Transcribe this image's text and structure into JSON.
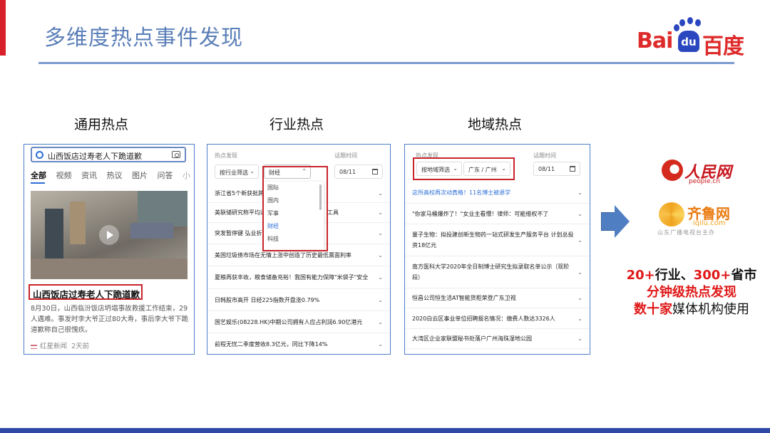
{
  "slide": {
    "title": "多维度热点事件发现",
    "logo": {
      "part1": "Bai",
      "du": "du",
      "part2": "百度"
    }
  },
  "headings": {
    "general": "通用热点",
    "industry": "行业热点",
    "region": "地域热点"
  },
  "general_panel": {
    "search_value": "山西饭店过寿老人下跪道歉",
    "tabs": [
      {
        "label": "全部",
        "active": true
      },
      {
        "label": "视频"
      },
      {
        "label": "资讯"
      },
      {
        "label": "热议"
      },
      {
        "label": "图片"
      },
      {
        "label": "问答"
      },
      {
        "label": "小"
      }
    ],
    "headline": "山西饭店过寿老人下跪道歉",
    "description": "8月30日，山西临汾饭店坍塌事故救援工作结束，29人遇难。事发时李大爷正过80大寿，事后李大爷下跪道歉称自己很愧疚。",
    "source_name": "红星新闻",
    "source_time": "2天前"
  },
  "industry_panel": {
    "filter_label": "热点发现",
    "time_label": "话题时间",
    "filter_select": "按行业筛选",
    "category_select": "财经",
    "date_value": "08/11",
    "dropdown_options": [
      "国际",
      "国内",
      "军事",
      "财经",
      "科技"
    ],
    "dropdown_selected": "财经",
    "rows": [
      "浙江省5个新获批跨境",
      "美联储研究称平均通",
      "突发暂停键 弘业折载",
      "美国垃圾债市场在无情上涨中创造了历史最低票面利率",
      "夏粮再获丰收，粮食储备充裕！我国有能力保障\"米袋子\"安全",
      "日韩股市高开 日经225指数开盘涨0.79%",
      "国艺娱乐(08228.HK)中期公司拥有人应占利润6.90亿港元",
      "前程无忧二季度营收8.3亿元，同比下降14%"
    ],
    "row2_tail": "工具"
  },
  "region_panel": {
    "filter_label": "热点发现",
    "time_label": "话题时间",
    "filter_select": "按地域筛选",
    "region_select": "广东 / 广州",
    "date_value": "08/11",
    "rows": [
      "这所高校再次动真格！11名博士被退学",
      "\"你家马桶爆炸了！\"女业主看懵！律师：可能维权不了",
      "量子生物：拟投建创新生物药一站式研发生产服务平台 计划总投资18亿元",
      "南方医科大学2020年全日制博士研究生拟录取名单公示（现阶段）",
      "恒昌公司恒生活AT智能货柜荣登广东卫视",
      "2020白云区事业单位招聘报名情况：缴费人数达3326人",
      "大湾区企业家联盟秘书处落户广州海珠湿地公园"
    ]
  },
  "media": {
    "people": {
      "name": "人民网",
      "url": "people.cn"
    },
    "qilu": {
      "name": "齐鲁网",
      "url": "iqilu.com",
      "sub": "山东广播电视台主办"
    }
  },
  "stats": {
    "l1a": "20+",
    "l1b": "行业、",
    "l1c": "300+",
    "l1d": "省市",
    "l2": "分钟级热点发现",
    "l3a": "数十家",
    "l3b": "媒体机构使用"
  },
  "colors": {
    "accent": "#5b7fb8",
    "highlight": "#c8242a",
    "link": "#2b6ed6",
    "bottom_bar": "#2e4aa6"
  }
}
